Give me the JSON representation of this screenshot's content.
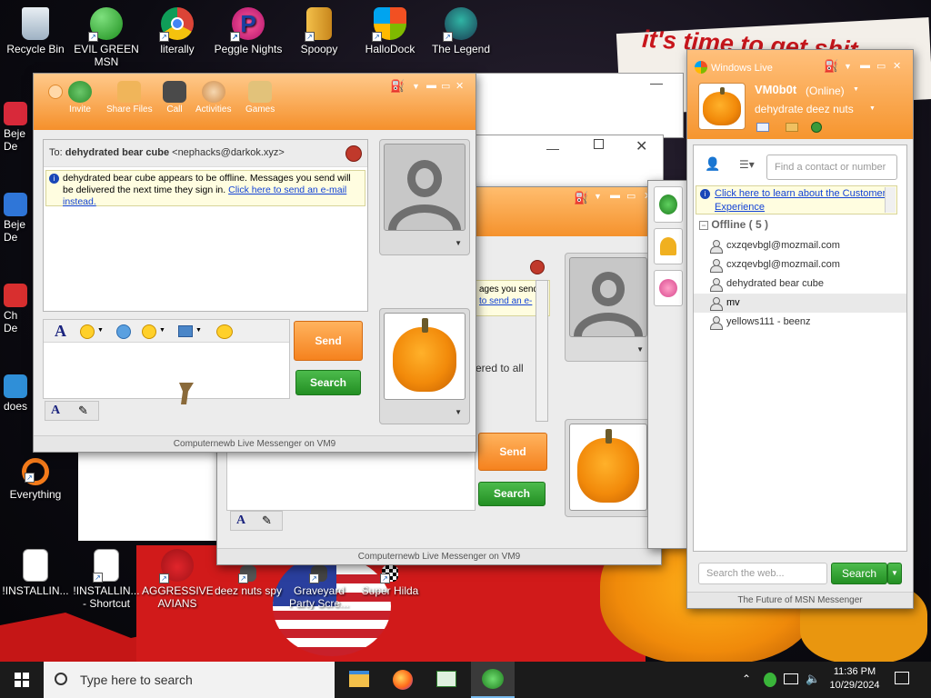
{
  "desktop": {
    "wallpaper_text": "it's time to get shit",
    "top_icons": [
      {
        "label": "Recycle Bin",
        "label2": ""
      },
      {
        "label": "EVIL GREEN",
        "label2": "MSN"
      },
      {
        "label": "literally",
        "label2": ""
      },
      {
        "label": "Peggle Nights",
        "label2": ""
      },
      {
        "label": "Spoopy",
        "label2": ""
      },
      {
        "label": "HalloDock",
        "label2": ""
      },
      {
        "label": "The Legend",
        "label2": ""
      }
    ],
    "side_icons": [
      {
        "label": "Beje",
        "label2": "De"
      },
      {
        "label": "Beje",
        "label2": "De"
      },
      {
        "label": "Ch",
        "label2": "De"
      },
      {
        "label": "does",
        "label2": ""
      }
    ],
    "everything_label": "Everything",
    "bottom_icons": [
      {
        "label": "!INSTALLIN...",
        "label2": ""
      },
      {
        "label": "!INSTALLIN...",
        "label2": "- Shortcut"
      },
      {
        "label": "AGGRESSIVE",
        "label2": "AVIANS"
      },
      {
        "label": "deez nuts spy",
        "label2": ""
      },
      {
        "label": "Graveyard",
        "label2": "Party Scre..."
      },
      {
        "label": "Super Hilda",
        "label2": ""
      }
    ]
  },
  "chat_main": {
    "toolbar": [
      "Invite",
      "Share Files",
      "Call",
      "Activities",
      "Games"
    ],
    "to_prefix": "To:",
    "to_name": "dehydrated bear cube",
    "to_email": "<nephacks@darkok.xyz>",
    "info_text": "dehydrated bear cube appears to be offline. Messages you send will be delivered the next time they sign in.",
    "info_link": "Click here to send an e-mail instead.",
    "send_label": "Send",
    "search_label": "Search",
    "footer": "Computernewb Live Messenger on VM9"
  },
  "chat_back": {
    "info_text": "ages you send",
    "info_link": "to send an e-",
    "body_text": "ered to all",
    "send_label": "Send",
    "search_label": "Search",
    "footer": "Computernewb Live Messenger on VM9"
  },
  "contacts": {
    "window_title": "Windows Live",
    "username": "VM0b0t",
    "status": "(Online)",
    "personal_message": "dehydrate deez nuts",
    "find_placeholder": "Find a contact or number",
    "promo_link": "Click here to learn about the Customer Experience",
    "group_label": "Offline ( 5 )",
    "contacts": [
      "cxzqevbgl@mozmail.com",
      "cxzqevbgl@mozmail.com",
      "dehydrated bear cube",
      "mv",
      "yellows111 - beenz"
    ],
    "web_search_placeholder": "Search the web...",
    "search_label": "Search",
    "footer": "The Future of MSN Messenger"
  },
  "taskbar": {
    "search_placeholder": "Type here to search",
    "time": "11:36 PM",
    "date": "10/29/2024"
  },
  "colors": {
    "accent_orange": "#f5922d",
    "accent_green": "#238f23",
    "link_blue": "#1343d6"
  }
}
